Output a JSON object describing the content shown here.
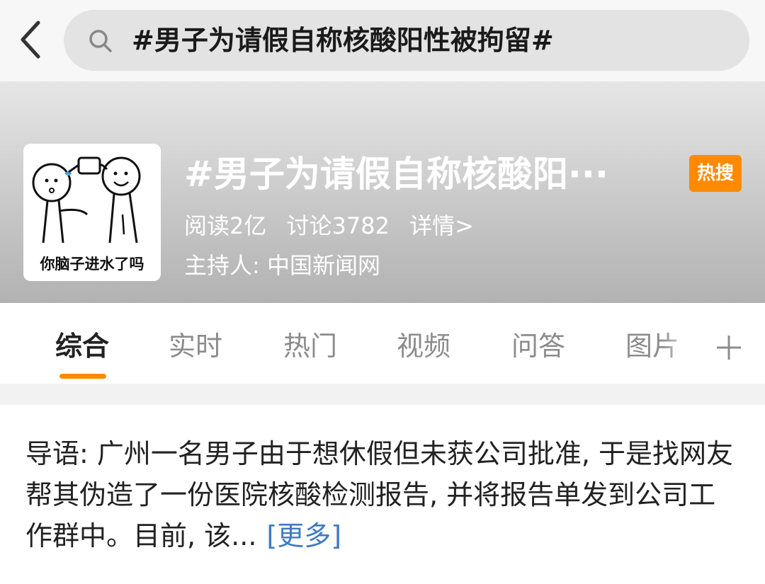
{
  "search": {
    "query": "#男子为请假自称核酸阳性被拘留#"
  },
  "topic": {
    "thumbnail_caption": "你脑子进水了吗",
    "title": "#男子为请假自称核酸阳···",
    "hot_badge": "热搜",
    "reads": "阅读2亿",
    "discussions": "讨论3782",
    "details_link": "详情>",
    "host": "主持人: 中国新闻网"
  },
  "tabs": [
    {
      "label": "综合",
      "active": true
    },
    {
      "label": "实时"
    },
    {
      "label": "热门"
    },
    {
      "label": "视频"
    },
    {
      "label": "问答"
    },
    {
      "label": "图片"
    }
  ],
  "intro": {
    "text": "导语: 广州一名男子由于想休假但未获公司批准, 于是找网友帮其伪造了一份医院核酸检测报告, 并将报告单发到公司工作群中。目前, 该...",
    "more": "[更多]"
  },
  "colors": {
    "accent": "#ff8a00",
    "link": "#3d7bbf"
  },
  "icons": [
    "back-arrow-icon",
    "search-icon",
    "plus-icon"
  ]
}
